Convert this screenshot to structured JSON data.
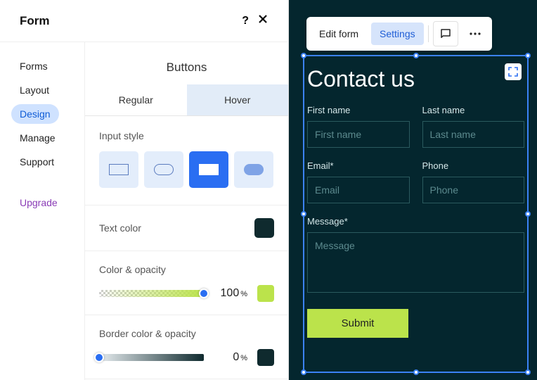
{
  "panel": {
    "title": "Form",
    "sidebar": {
      "items": [
        "Forms",
        "Layout",
        "Design",
        "Manage",
        "Support"
      ],
      "active_index": 2,
      "upgrade": "Upgrade"
    },
    "section_title": "Buttons",
    "tabs": {
      "regular": "Regular",
      "hover": "Hover"
    },
    "input_style": {
      "label": "Input style"
    },
    "text_color": {
      "label": "Text color",
      "value": "#0f2a2e"
    },
    "color_opacity": {
      "label": "Color & opacity",
      "value": "100",
      "unit": "%",
      "swatch": "#bbe34b"
    },
    "border_opacity": {
      "label": "Border color & opacity",
      "value": "0",
      "unit": "%",
      "swatch": "#0f2a2e"
    }
  },
  "toolbar": {
    "edit": "Edit form",
    "settings": "Settings"
  },
  "form": {
    "heading": "Contact us",
    "first_name": {
      "label": "First name",
      "placeholder": "First name"
    },
    "last_name": {
      "label": "Last name",
      "placeholder": "Last name"
    },
    "email": {
      "label": "Email*",
      "placeholder": "Email"
    },
    "phone": {
      "label": "Phone",
      "placeholder": "Phone"
    },
    "message": {
      "label": "Message*",
      "placeholder": "Message"
    },
    "submit": "Submit"
  }
}
